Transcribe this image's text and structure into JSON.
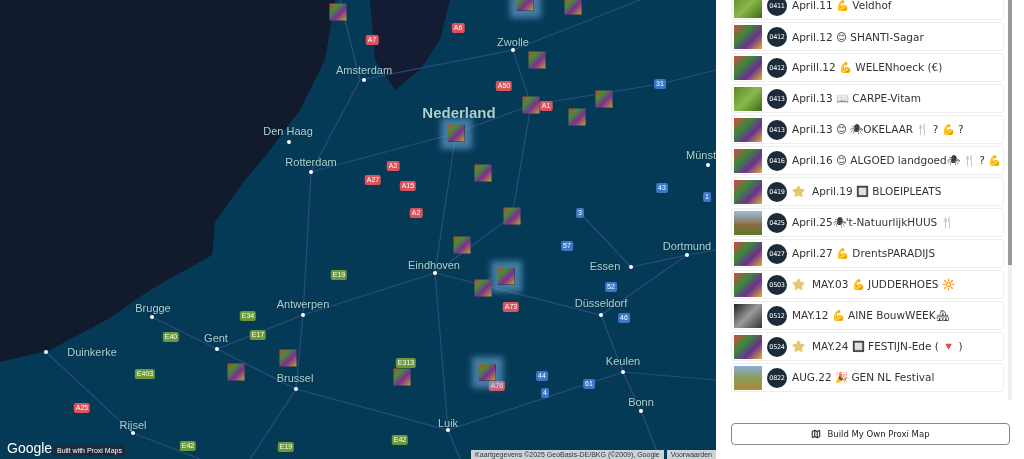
{
  "map": {
    "places": [
      {
        "name": "Amsterdam",
        "kind": "city"
      },
      {
        "name": "Den Haag",
        "kind": "city"
      },
      {
        "name": "Rotterdam",
        "kind": "city"
      },
      {
        "name": "Nederland",
        "kind": "country"
      },
      {
        "name": "Zwolle",
        "kind": "city"
      },
      {
        "name": "Münst",
        "kind": "city"
      },
      {
        "name": "Dortmund",
        "kind": "city"
      },
      {
        "name": "Essen",
        "kind": "city"
      },
      {
        "name": "Düsseldorf",
        "kind": "city"
      },
      {
        "name": "Keulen",
        "kind": "city"
      },
      {
        "name": "Bonn",
        "kind": "city"
      },
      {
        "name": "Eindhoven",
        "kind": "city"
      },
      {
        "name": "Antwerpen",
        "kind": "city"
      },
      {
        "name": "Brugge",
        "kind": "city"
      },
      {
        "name": "Gent",
        "kind": "city"
      },
      {
        "name": "Duinkerke",
        "kind": "city"
      },
      {
        "name": "Brussel",
        "kind": "city"
      },
      {
        "name": "Rijsel",
        "kind": "city"
      },
      {
        "name": "Luik",
        "kind": "city"
      }
    ],
    "road_shields": [
      {
        "label": "A7",
        "kind": "a"
      },
      {
        "label": "A6",
        "kind": "a"
      },
      {
        "label": "A50",
        "kind": "a"
      },
      {
        "label": "A1",
        "kind": "a"
      },
      {
        "label": "A2",
        "kind": "a"
      },
      {
        "label": "A27",
        "kind": "a"
      },
      {
        "label": "A15",
        "kind": "a"
      },
      {
        "label": "A2",
        "kind": "a"
      },
      {
        "label": "A73",
        "kind": "a"
      },
      {
        "label": "A76",
        "kind": "a"
      },
      {
        "label": "A25",
        "kind": "a"
      },
      {
        "label": "E19",
        "kind": "e"
      },
      {
        "label": "E34",
        "kind": "e"
      },
      {
        "label": "E40",
        "kind": "e"
      },
      {
        "label": "E17",
        "kind": "e"
      },
      {
        "label": "E403",
        "kind": "e"
      },
      {
        "label": "E313",
        "kind": "e"
      },
      {
        "label": "E42",
        "kind": "e"
      },
      {
        "label": "E19",
        "kind": "e"
      },
      {
        "label": "E42",
        "kind": "e"
      },
      {
        "label": "31",
        "kind": "de"
      },
      {
        "label": "43",
        "kind": "de"
      },
      {
        "label": "1",
        "kind": "de"
      },
      {
        "label": "3",
        "kind": "de"
      },
      {
        "label": "57",
        "kind": "de"
      },
      {
        "label": "52",
        "kind": "de"
      },
      {
        "label": "46",
        "kind": "de"
      },
      {
        "label": "44",
        "kind": "de"
      },
      {
        "label": "61",
        "kind": "de"
      },
      {
        "label": "4",
        "kind": "de"
      }
    ],
    "pins": [
      {
        "highlighted": false
      },
      {
        "highlighted": true
      },
      {
        "highlighted": false
      },
      {
        "highlighted": false
      },
      {
        "highlighted": false
      },
      {
        "highlighted": false
      },
      {
        "highlighted": false
      },
      {
        "highlighted": true
      },
      {
        "highlighted": false
      },
      {
        "highlighted": false
      },
      {
        "highlighted": false
      },
      {
        "highlighted": true
      },
      {
        "highlighted": false
      },
      {
        "highlighted": false
      },
      {
        "highlighted": false
      },
      {
        "highlighted": false
      },
      {
        "highlighted": true
      }
    ],
    "logo": "Google",
    "credit": "Built with Proxi Maps",
    "attribution": "Kaartgegevens ©2025 GeoBasis-DE/BKG (©2009), Google",
    "terms": "Voorwaarden"
  },
  "events": [
    {
      "badge": "0411",
      "text": "April.11 💪 Veldhof",
      "starred": false,
      "kind": "garden"
    },
    {
      "badge": "0412",
      "text": "April.12 😊 SHANTI-Sagar",
      "starred": false,
      "kind": "poster"
    },
    {
      "badge": "0412",
      "text": "Aprill.12 💪 WELENhoeck (€)",
      "starred": false,
      "kind": "poster"
    },
    {
      "badge": "0413",
      "text": "April.13 📖 CARPE-Vitam",
      "starred": false,
      "kind": "garden"
    },
    {
      "badge": "0413",
      "text": "April.13 😊 🕷OKELAAR 🍴 ? 💪 ?",
      "starred": false,
      "kind": "poster"
    },
    {
      "badge": "0416",
      "text": "April.16 😊 ALGOED landgoed🕷 🍴 ? 💪",
      "starred": false,
      "kind": "poster"
    },
    {
      "badge": "0419",
      "text": "April.19 🔲 BLOEIPLEATS",
      "starred": true,
      "kind": "poster"
    },
    {
      "badge": "0425",
      "text": "April.25🕷't-NatuurlijkHUUS 🍴",
      "starred": false,
      "kind": "house"
    },
    {
      "badge": "0427",
      "text": "April.27 💪 DrentsPARADIJS",
      "starred": false,
      "kind": "poster"
    },
    {
      "badge": "0503",
      "text": "MAY.03 💪 JUDDERHOES 🔆",
      "starred": true,
      "kind": "poster"
    },
    {
      "badge": "0512",
      "text": "MAY.12 💪 AINE BouwWEEK🏘",
      "starred": false,
      "kind": "bw"
    },
    {
      "badge": "0524",
      "text": "MAY.24 🔲 FESTIJN-Ede ( 🔻 )",
      "starred": true,
      "kind": "poster"
    },
    {
      "badge": "0822",
      "text": "AUG.22 🎉 GEN NL Festival",
      "starred": false,
      "kind": "field"
    }
  ],
  "build_button": "Build My Own Proxi Map"
}
